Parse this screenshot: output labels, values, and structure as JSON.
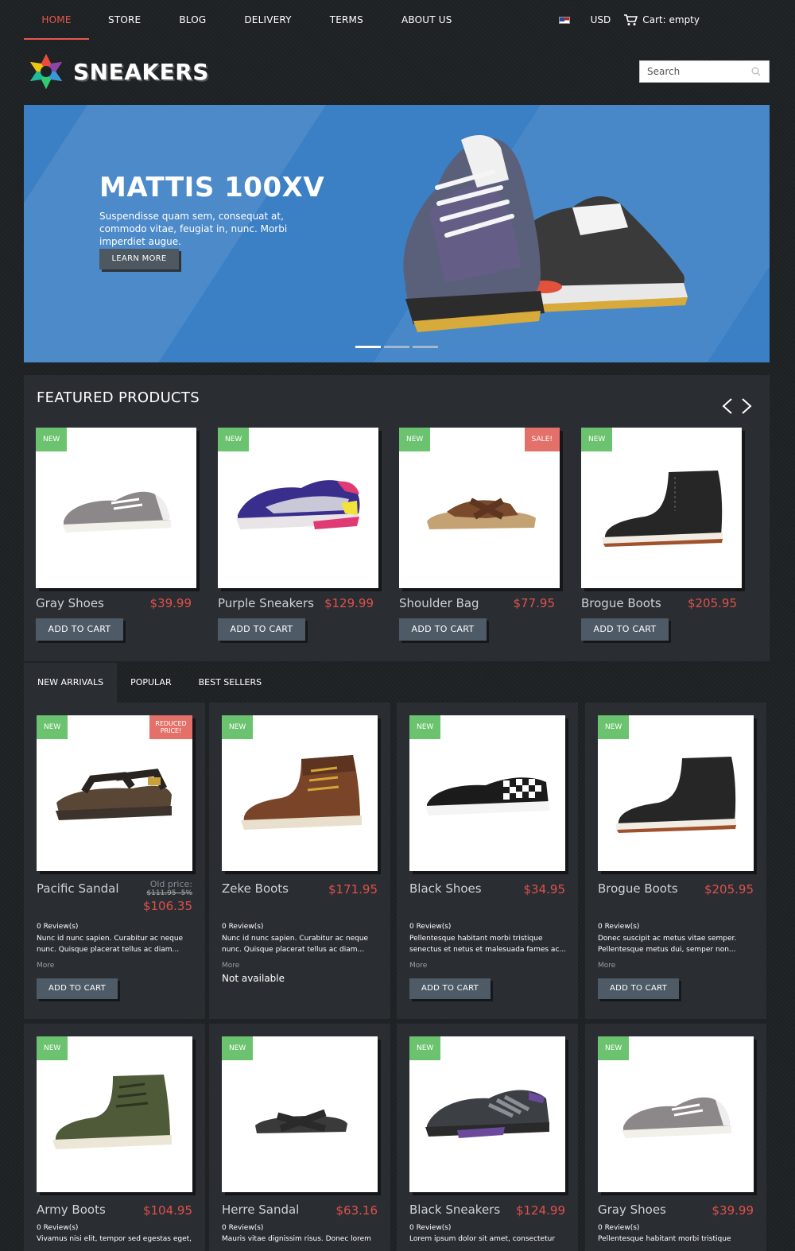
{
  "nav": {
    "items": [
      "HOME",
      "STORE",
      "BLOG",
      "DELIVERY",
      "TERMS",
      "ABOUT US"
    ],
    "currency": "USD",
    "cart": "Cart: empty"
  },
  "header": {
    "logo": "SNEAKERS",
    "search_placeholder": "Search"
  },
  "hero": {
    "title": "MATTIS 100XV",
    "text": "Suspendisse quam sem, consequat at, commodo vitae, feugiat in, nunc. Morbi imperdiet augue.",
    "button": "LEARN MORE"
  },
  "featured": {
    "title": "FEATURED PRODUCTS",
    "products": [
      {
        "name": "Gray Shoes",
        "price": "$39.99",
        "badge": "NEW",
        "button": "ADD TO CART"
      },
      {
        "name": "Purple Sneakers",
        "price": "$129.99",
        "badge": "NEW",
        "button": "ADD TO CART"
      },
      {
        "name": "Shoulder Bag",
        "price": "$77.95",
        "badge": "NEW",
        "badge2": "SALE!",
        "button": "ADD TO CART"
      },
      {
        "name": "Brogue Boots",
        "price": "$205.95",
        "badge": "NEW",
        "button": "ADD TO CART"
      }
    ]
  },
  "tabs": [
    "NEW ARRIVALS",
    "POPULAR",
    "BEST SELLERS"
  ],
  "products": [
    {
      "name": "Pacific Sandal",
      "old_label": "Old price:",
      "old_price": "$111.95 -5%",
      "price": "$106.35",
      "badge": "NEW",
      "reduced": "REDUCED PRICE!",
      "reviews": "0 Review(s)",
      "desc": "Nunc id nunc sapien. Curabitur ac neque nunc. Quisque placerat tellus ac diam...",
      "more": "More",
      "button": "ADD TO CART"
    },
    {
      "name": "Zeke Boots",
      "price": "$171.95",
      "badge": "NEW",
      "reviews": "0 Review(s)",
      "desc": "Nunc id nunc sapien. Curabitur ac neque nunc. Quisque placerat tellus ac diam...",
      "more": "More",
      "unavailable": "Not available"
    },
    {
      "name": "Black Shoes",
      "price": "$34.95",
      "badge": "NEW",
      "reviews": "0 Review(s)",
      "desc": "Pellentesque habitant morbi tristique senectus et netus et malesuada fames ac...",
      "more": "More",
      "button": "ADD TO CART"
    },
    {
      "name": "Brogue Boots",
      "price": "$205.95",
      "badge": "NEW",
      "reviews": "0 Review(s)",
      "desc": "Donec suscipit ac metus vitae semper. Pellentesque metus dui, semper non...",
      "more": "More",
      "button": "ADD TO CART"
    },
    {
      "name": "Army Boots",
      "price": "$104.95",
      "badge": "NEW",
      "reviews": "0 Review(s)",
      "desc": "Vivamus nisi elit, tempor sed egestas eget,"
    },
    {
      "name": "Herre Sandal",
      "price": "$63.16",
      "badge": "NEW",
      "reviews": "0 Review(s)",
      "desc": "Mauris vitae dignissim risus. Donec lorem"
    },
    {
      "name": "Black Sneakers",
      "price": "$124.99",
      "badge": "NEW",
      "reviews": "0 Review(s)",
      "desc": "Lorem ipsum dolor sit amet, consectetur"
    },
    {
      "name": "Gray Shoes",
      "price": "$39.99",
      "badge": "NEW",
      "reviews": "0 Review(s)",
      "desc": "Pellentesque habitant morbi tristique"
    }
  ]
}
